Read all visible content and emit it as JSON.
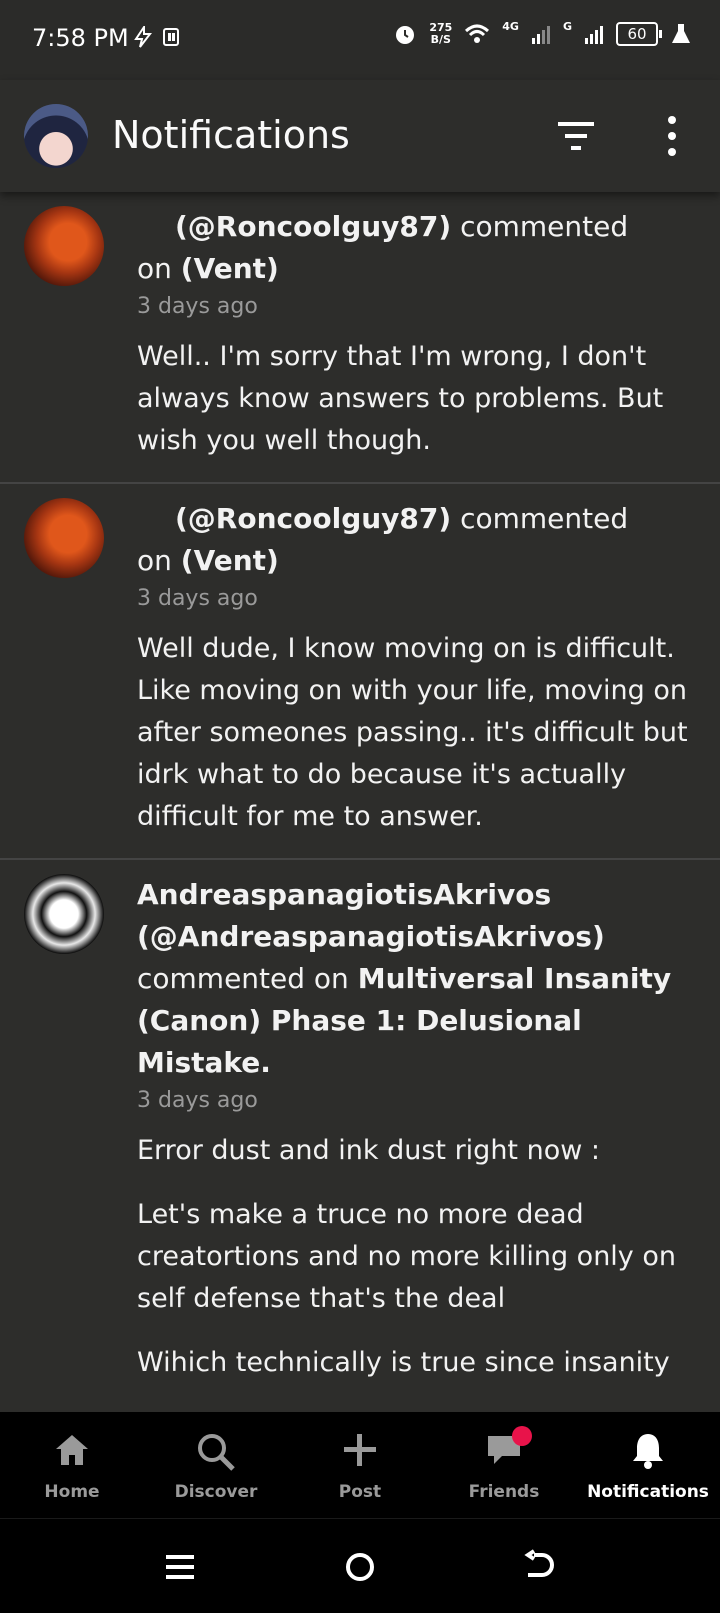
{
  "status_bar": {
    "time": "7:58 PM",
    "speed_value": "275",
    "speed_unit": "B/S",
    "net1": "4G",
    "net2": "G",
    "battery": "60"
  },
  "header": {
    "title": "Notifications"
  },
  "notifications": [
    {
      "name": "",
      "handle": "(@Roncoolguy87)",
      "action": "commented",
      "on": "on",
      "target": "(Vent)",
      "time": "3 days ago",
      "messages": [
        "Well.. I'm sorry that I'm wrong, I don't always know answers to problems. But wish you well though."
      ]
    },
    {
      "name": "",
      "handle": "(@Roncoolguy87)",
      "action": "commented",
      "on": "on",
      "target": "(Vent)",
      "time": "3 days ago",
      "messages": [
        "Well dude, I know moving on is difficult. Like moving on with your life, moving on after someones passing.. it's difficult but idrk what to do because it's actually difficult for me to answer."
      ]
    },
    {
      "name": "AndreaspanagiotisAkrivos",
      "handle": "(@AndreaspanagiotisAkrivos)",
      "action": "commented on",
      "target": "Multiversal Insanity (Canon) Phase 1: Delusional Mistake.",
      "time": "3 days ago",
      "messages": [
        "Error dust and ink dust right now :",
        "Let's make a truce no more dead creatortions and no more killing only on self defense that's the deal",
        "Wihich technically is true since insanity"
      ]
    }
  ],
  "bottom_nav": {
    "home": "Home",
    "discover": "Discover",
    "post": "Post",
    "friends": "Friends",
    "notifications": "Notifications"
  },
  "colors": {
    "background": "#2d2d2b",
    "badge": "#e8134a",
    "nav_background": "#000000"
  }
}
